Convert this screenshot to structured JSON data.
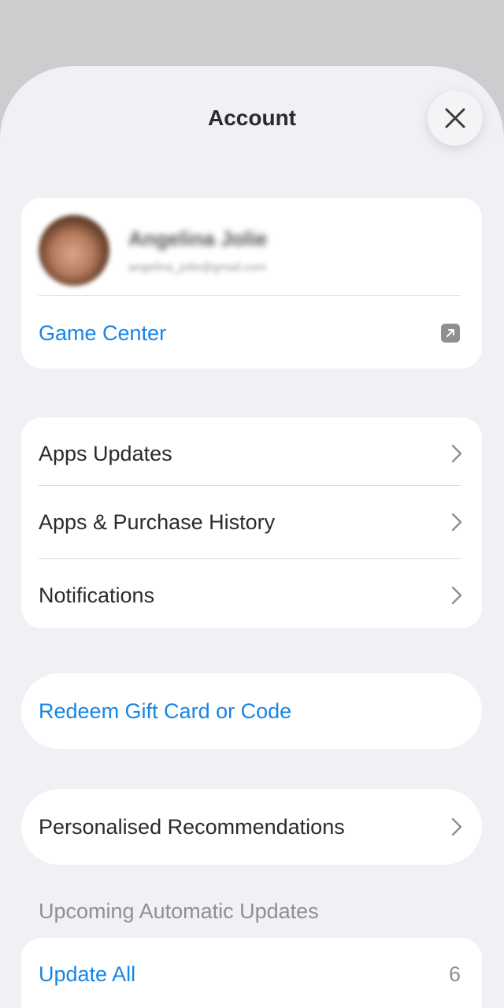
{
  "sheet": {
    "title": "Account",
    "close_icon": "close-icon"
  },
  "profile": {
    "name": "Angelina Jolie",
    "email": "angelina_jolie@gmail.com",
    "game_center_label": "Game Center",
    "game_center_icon": "external-link-icon"
  },
  "menu": {
    "items": [
      {
        "label": "Apps Updates"
      },
      {
        "label": "Apps & Purchase History"
      },
      {
        "label": "Notifications"
      }
    ]
  },
  "redeem": {
    "label": "Redeem Gift Card or Code"
  },
  "recommendations": {
    "label": "Personalised Recommendations"
  },
  "automatic_updates": {
    "header": "Upcoming Automatic Updates",
    "update_all_label": "Update All",
    "count": "6"
  },
  "colors": {
    "accent": "#1685e6",
    "background": "#f0f0f5",
    "card": "#ffffff",
    "secondary_text": "#8e8e93"
  }
}
